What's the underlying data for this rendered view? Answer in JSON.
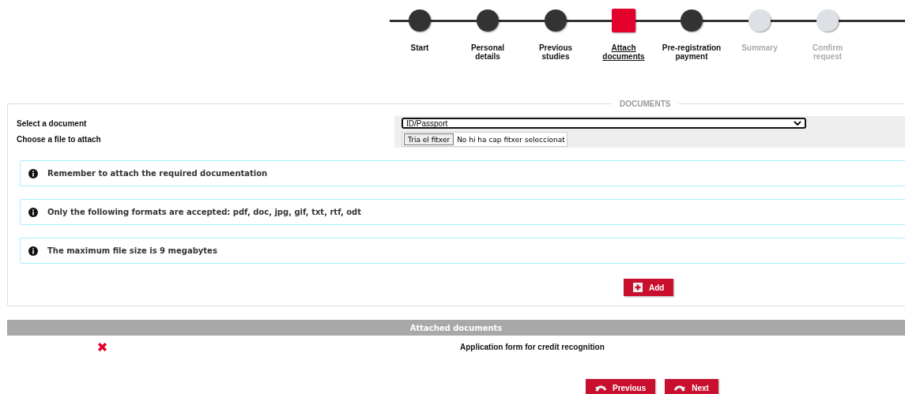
{
  "steps": [
    {
      "label": "Start",
      "completed": true,
      "selected": false
    },
    {
      "label": "Personal details",
      "completed": true,
      "selected": false
    },
    {
      "label": "Previous studies",
      "completed": true,
      "selected": false
    },
    {
      "label": "Attach documents",
      "selected": true
    },
    {
      "label": "Pre-registration payment",
      "completed": true,
      "selected": false
    },
    {
      "label": "Summary",
      "completed": false,
      "selected": false
    },
    {
      "label": "Confirm request",
      "completed": false,
      "selected": false
    }
  ],
  "documents": {
    "legend": "DOCUMENTS",
    "select_label": "Select a document",
    "select_value": "ID/Passport",
    "file_label": "Choose a file to attach",
    "file_button": "Tria el fitxer",
    "file_status": "No hi ha cap fitxer seleccionat",
    "notices": [
      "Remember to attach the required documentation",
      "Only the following formats are accepted: pdf, doc, jpg, gif, txt, rtf, odt",
      "The maximum file size is 9 megabytes"
    ],
    "add_button": "Add"
  },
  "attached": {
    "title": "Attached documents",
    "rows": [
      {
        "name": "Application form for credit recognition"
      }
    ]
  },
  "buttons": {
    "previous": "Previous",
    "next": "Next"
  }
}
